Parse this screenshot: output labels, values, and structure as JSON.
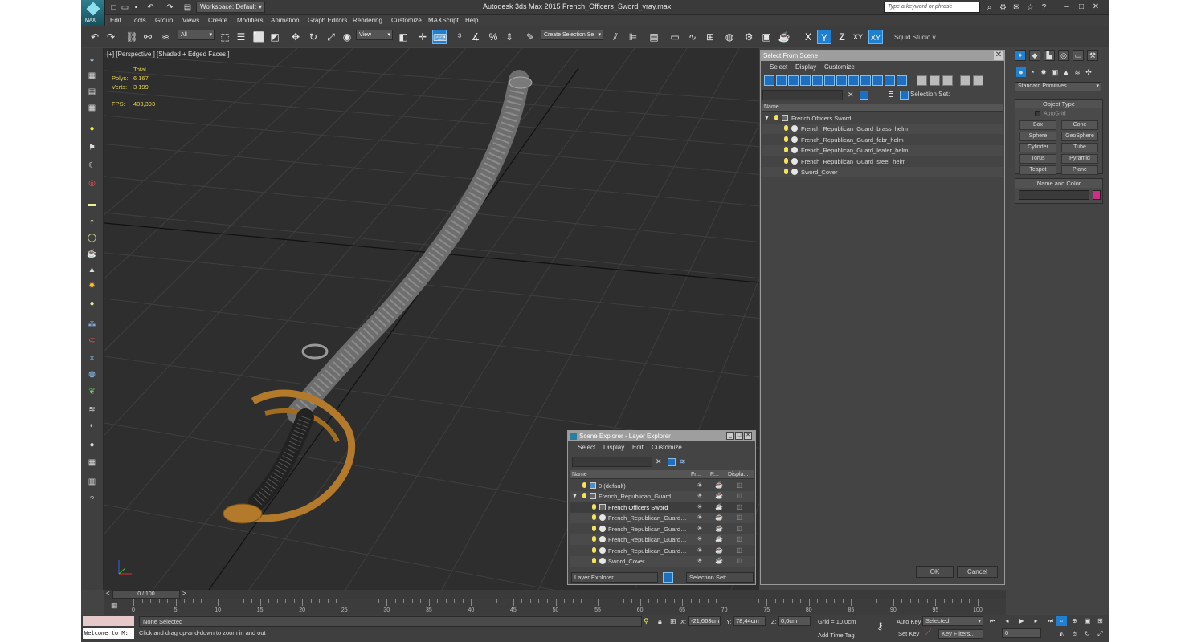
{
  "titlebar": {
    "workspace": "Workspace: Default",
    "title": "Autodesk 3ds Max  2015     French_Officers_Sword_vray.max",
    "search_placeholder": "Type a keyword or phrase",
    "logo_text": "MAX"
  },
  "menu": [
    "Edit",
    "Tools",
    "Group",
    "Views",
    "Create",
    "Modifiers",
    "Animation",
    "Graph Editors",
    "Rendering",
    "Customize",
    "MAXScript",
    "Help"
  ],
  "toolbar": {
    "filter_value": "All",
    "ref_coord": "View",
    "selection_set": "Create Selection Se",
    "squid": "Squid Studio v",
    "axis_x": "X",
    "axis_y": "Y",
    "axis_z": "Z",
    "axis_xy": "XY",
    "axis_xy2": "XY"
  },
  "viewport": {
    "label": "[+] [Perspective ] [Shaded + Edged Faces ]",
    "stats_header": "Total",
    "polys_label": "Polys:",
    "polys_value": "6 167",
    "verts_label": "Verts:",
    "verts_value": "3 199",
    "fps_label": "FPS:",
    "fps_value": "403,393"
  },
  "select_from_scene": {
    "title": "Select From Scene",
    "menu": [
      "Select",
      "Display",
      "Customize"
    ],
    "selection_set_label": "Selection Set:",
    "column_name": "Name",
    "items": [
      {
        "name": "French Officers Sword",
        "level": 0
      },
      {
        "name": "French_Republican_Guard_brass_helm",
        "level": 1
      },
      {
        "name": "French_Republican_Guard_fabr_helm",
        "level": 1
      },
      {
        "name": "French_Republican_Guard_leater_helm",
        "level": 1
      },
      {
        "name": "French_Republican_Guard_steel_helm",
        "level": 1
      },
      {
        "name": "Sword_Cover",
        "level": 1
      }
    ],
    "ok_label": "OK",
    "cancel_label": "Cancel"
  },
  "scene_explorer": {
    "title": "Scene Explorer - Layer Explorer",
    "menu": [
      "Select",
      "Display",
      "Edit",
      "Customize"
    ],
    "columns": [
      "Name",
      "Fr...",
      "R...",
      "Displa..."
    ],
    "rows": [
      {
        "name": "0 (default)",
        "level": 0
      },
      {
        "name": "French_Republican_Guard",
        "level": 0
      },
      {
        "name": "French Officers Sword",
        "level": 1
      },
      {
        "name": "French_Republican_Guard_...",
        "level": 1
      },
      {
        "name": "French_Republican_Guard_...",
        "level": 1
      },
      {
        "name": "French_Republican_Guard_l...",
        "level": 1
      },
      {
        "name": "French_Republican_Guard_...",
        "level": 1
      },
      {
        "name": "Sword_Cover",
        "level": 1
      }
    ],
    "explorer_select": "Layer Explorer",
    "selection_set_label": "Selection Set:"
  },
  "command_panel": {
    "category": "Standard Primitives",
    "object_type_title": "Object Type",
    "autogrid": "AutoGrid",
    "primitives": [
      "Box",
      "Cone",
      "Sphere",
      "GeoSphere",
      "Cylinder",
      "Tube",
      "Torus",
      "Pyramid",
      "Teapot",
      "Plane"
    ],
    "name_color_title": "Name and Color",
    "object_color": "#d12c8a"
  },
  "timeline": {
    "frame_label": "0 / 100",
    "ticks": [
      0,
      5,
      10,
      15,
      20,
      25,
      30,
      35,
      40,
      45,
      50,
      55,
      60,
      65,
      70,
      75,
      80,
      85,
      90,
      95,
      100
    ]
  },
  "status": {
    "maxscript_text": "Welcome to M:",
    "selection": "None Selected",
    "prompt": "Click and drag up-and-down to zoom in and out",
    "x_label": "X:",
    "x_value": "-21,663cm",
    "y_label": "Y:",
    "y_value": "78,44cm",
    "z_label": "Z:",
    "z_value": "0,0cm",
    "grid": "Grid = 10,0cm",
    "add_time_tag": "Add Time Tag",
    "auto_key": "Auto Key",
    "set_key": "Set Key",
    "key_mode": "Selected",
    "key_filters": "Key Filters...",
    "frame": "0"
  },
  "colors": {
    "accent": "#1f7fd0",
    "viewport_bg": "#2e2e2e",
    "stats_text": "#e4d34f"
  }
}
